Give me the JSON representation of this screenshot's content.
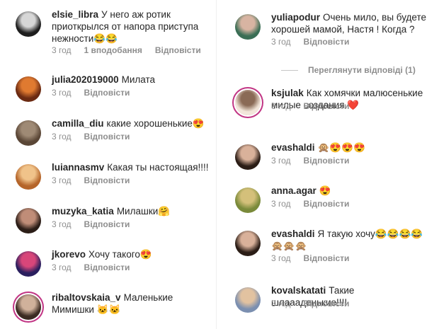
{
  "left": [
    {
      "user": "elsie_libra",
      "text": "У него аж ротик приоткрылся от напора приступа нежности😂😂",
      "time": "3 год",
      "likes": "1 вподобання",
      "reply": "Відповісти",
      "colors": [
        "#1e1e1e",
        "#d7d7d7"
      ]
    },
    {
      "user": "julia202019000",
      "text": "Милата",
      "time": "3 год",
      "reply": "Відповісти",
      "colors": [
        "#6b2a12",
        "#e07a30"
      ]
    },
    {
      "user": "camilla_diu",
      "text": "какие хорошенькие😍",
      "time": "3 год",
      "reply": "Відповісти",
      "colors": [
        "#5a4636",
        "#9f8a75"
      ]
    },
    {
      "user": "luiannasmv",
      "text": "Какая ты настоящая!!!!",
      "time": "3 год",
      "reply": "Відповісти",
      "colors": [
        "#b5652a",
        "#f0c38a"
      ]
    },
    {
      "user": "muzyka_katia",
      "text": "Милашки🤗",
      "time": "3 год",
      "reply": "Відповісти",
      "colors": [
        "#2b1d17",
        "#c08d78"
      ]
    },
    {
      "user": "jkorevo",
      "text": "Хочу такого😍",
      "time": "3 год",
      "reply": "Відповісти",
      "colors": [
        "#2a1f5e",
        "#d8467a"
      ]
    },
    {
      "user": "ribaltovskaia_v",
      "text": "Маленькие Мимишки 🐱🐱",
      "time": "",
      "reply": "",
      "colors": [
        "#3b2b22",
        "#d0b19b"
      ]
    }
  ],
  "right": [
    {
      "user": "yuliapodur",
      "text": "Очень мило, вы будете хорошей мамой, Настя ! Когда ?",
      "time": "3 год",
      "reply": "Відповісти",
      "colors": [
        "#3a6e55",
        "#d8b4a2"
      ]
    },
    {
      "user": "ksjulak",
      "text": "Как хомячки малюсенькие милые создания ❤️",
      "time": "3 год",
      "reply": "Відповісти",
      "colors": [
        "#f2e6da",
        "#8a6a56"
      ]
    },
    {
      "user": "evashaldi",
      "text": "🙊😍😍😍",
      "time": "3 год",
      "reply": "Відповісти",
      "colors": [
        "#2b1d16",
        "#d9b19a"
      ]
    },
    {
      "user": "anna.agar",
      "text": "😍",
      "time": "3 год",
      "reply": "Відповісти",
      "colors": [
        "#7a8a3a",
        "#d4c07a"
      ]
    },
    {
      "user": "evashaldi",
      "text": "Я такую хочу😂😂😂😂🙊🙊🙊",
      "time": "3 год",
      "reply": "Відповісти",
      "colors": [
        "#2b1d16",
        "#d9b19a"
      ]
    },
    {
      "user": "kovalskatati",
      "text": "Такие шлаааденькие!!!!",
      "time": "3 год",
      "reply": "Відповісти",
      "colors": [
        "#7b8fb0",
        "#e2c2a0"
      ]
    }
  ],
  "view_replies_label": "Переглянути відповіді (1)"
}
